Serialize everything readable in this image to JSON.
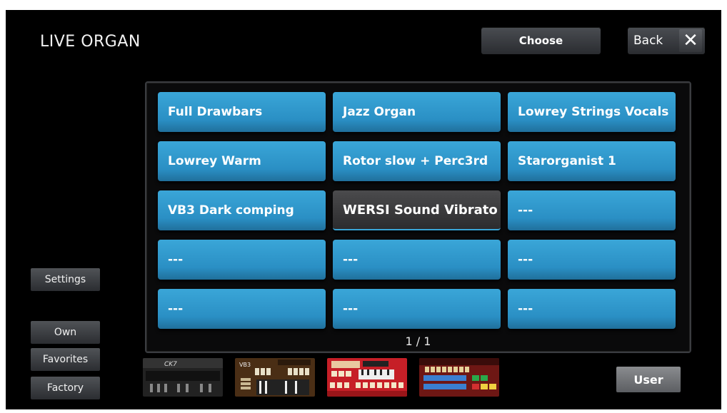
{
  "header": {
    "title": "LIVE ORGAN",
    "choose_label": "Choose",
    "back_label": "Back",
    "close_glyph": "✕"
  },
  "sounds": [
    "Full Drawbars",
    "Jazz Organ",
    "Lowrey Strings Vocals",
    "Lowrey Warm",
    "Rotor slow + Perc3rd",
    "Starorganist 1",
    "VB3 Dark comping",
    "WERSI Sound Vibrato",
    "---",
    "---",
    "---",
    "---",
    "---",
    "---",
    "---"
  ],
  "selected_index": 7,
  "pager": "1 / 1",
  "side": {
    "settings": "Settings",
    "own": "Own",
    "favorites": "Favorites",
    "factory": "Factory"
  },
  "user_label": "User",
  "thumbnails": [
    {
      "name": "organ-panel-ck7",
      "label": "CK7",
      "color": "#2a2a2a"
    },
    {
      "name": "organ-panel-vb3",
      "label": "VB3",
      "color": "#5a3a1c"
    },
    {
      "name": "organ-panel-red",
      "label": "",
      "color": "#c8202a"
    },
    {
      "name": "organ-panel-wersi",
      "label": "",
      "color": "#7a1a18"
    }
  ],
  "colors": {
    "tile": "#2a8fc4",
    "selected_tile": "#3a3a3c",
    "background": "#000000"
  }
}
